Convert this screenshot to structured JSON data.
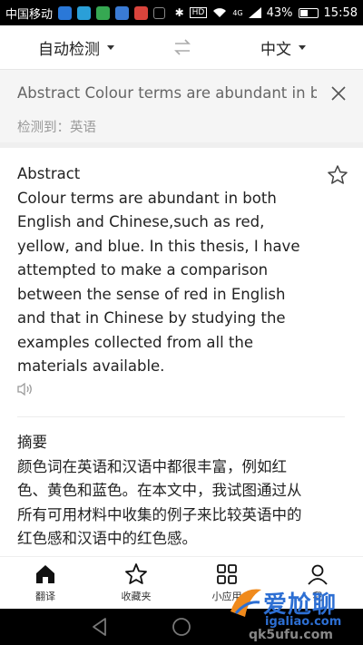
{
  "status_bar": {
    "carrier": "中国移动",
    "signal": "4G",
    "battery": "43%",
    "time": "15:58",
    "battery_level": 0.43,
    "app_icon_colors": [
      "#2a78d8",
      "#2a9fd8",
      "#36a852",
      "#3a7bd5",
      "#d9443c"
    ]
  },
  "language_bar": {
    "source_lang": "自动检测",
    "target_lang": "中文"
  },
  "input": {
    "text": "Abstract Colour terms are abundant in both",
    "detected_label": "检测到：",
    "detected_lang": "英语"
  },
  "result": {
    "english": "Abstract\nColour terms are abundant in both\nEnglish and Chinese,such as red,\nyellow, and blue. In this thesis, I have\nattempted to make a comparison\nbetween the sense of red in English\nand that in Chinese by studying the\nexamples collected from all the\nmaterials available.",
    "chinese": "摘要\n颜色词在英语和汉语中都很丰富，例如红\n色、黄色和蓝色。在本文中，我试图通过从\n所有可用材料中收集的例子来比较英语中的\n红色感和汉语中的红色感。"
  },
  "tabs": [
    {
      "label": "翻译",
      "icon": "translate-icon"
    },
    {
      "label": "收藏夹",
      "icon": "star-icon"
    },
    {
      "label": "小应用",
      "icon": "grid-icon"
    },
    {
      "label": "我",
      "icon": "person-icon"
    }
  ],
  "watermark": {
    "text": "爱尬聊",
    "url": "igaliao.com",
    "url2": "qk5ufu.com"
  },
  "colors": {
    "accent": "#2d6fd3",
    "text_primary": "#222222",
    "text_secondary": "#999999",
    "input_bg": "#f5f5f5"
  }
}
